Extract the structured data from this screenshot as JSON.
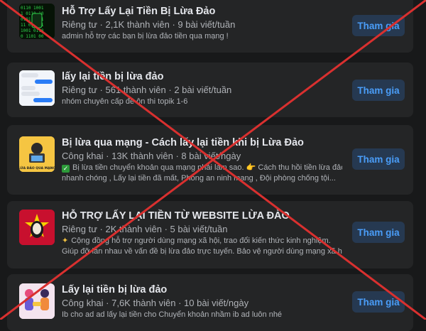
{
  "join_label": "Tham gia",
  "groups": [
    {
      "name": "Hỗ Trợ Lấy Lại Tiền Bị Lừa Đảo",
      "privacy": "Riêng tư",
      "members": "2,1K thành viên",
      "posts": "9 bài viết/tuần",
      "desc_lines": [
        "admin hỗ trợ các bạn bị lừa đảo tiền qua mạng !"
      ]
    },
    {
      "name": "lấy lại tiền bị lừa đảo",
      "privacy": "Riêng tư",
      "members": "561 thành viên",
      "posts": "2 bài viết/tuần",
      "desc_lines": [
        "nhóm chuyên cấp đề ôn thi topik 1-6"
      ]
    },
    {
      "name": "Bị lừa qua mạng - Cách lấy lại tiền khi bị Lừa Đảo",
      "privacy": "Công khai",
      "members": "13K thành viên",
      "posts": "8 bài viết/ngày",
      "desc_lines": [
        "Bị lừa tiền chuyển khoản qua mạng phải làm sao. 👉 Cách thu hồi tiền lừa đảo",
        "nhanh chóng , Lấy lại tiền đã mất, Phòng an ninh mạng , Đội phòng chống tội..."
      ],
      "thumb_text": "LỪA ĐẢO QUA MẠNG"
    },
    {
      "name": "HỖ TRỢ LẤY LẠI TIỀN TỪ WEBSITE LỪA ĐẢO",
      "privacy": "Riêng tư",
      "members": "2K thành viên",
      "posts": "5 bài viết/tuần",
      "desc_lines": [
        "Cộng đồng hỗ trợ người dùng mạng xã hội, trao đổi kiến thức kinh nghiệm.",
        "Giúp đỡ lẫn nhau về vấn đề bị lừa đảo trực tuyến. Bảo vệ người dùng mạng xã hộ..."
      ]
    },
    {
      "name": "Lấy lại tiền bị lừa đảo",
      "privacy": "Công khai",
      "members": "7,6K thành viên",
      "posts": "10 bài viết/ngày",
      "desc_lines": [
        "Ib cho ad ad lấy lại tiền cho Chuyển khoản nhầm ib ad luôn nhé"
      ]
    }
  ],
  "colors": {
    "background": "#18191a",
    "card": "#242526",
    "join_bg": "#263951",
    "join_text": "#4a9df8",
    "cross": "#d9302f"
  }
}
